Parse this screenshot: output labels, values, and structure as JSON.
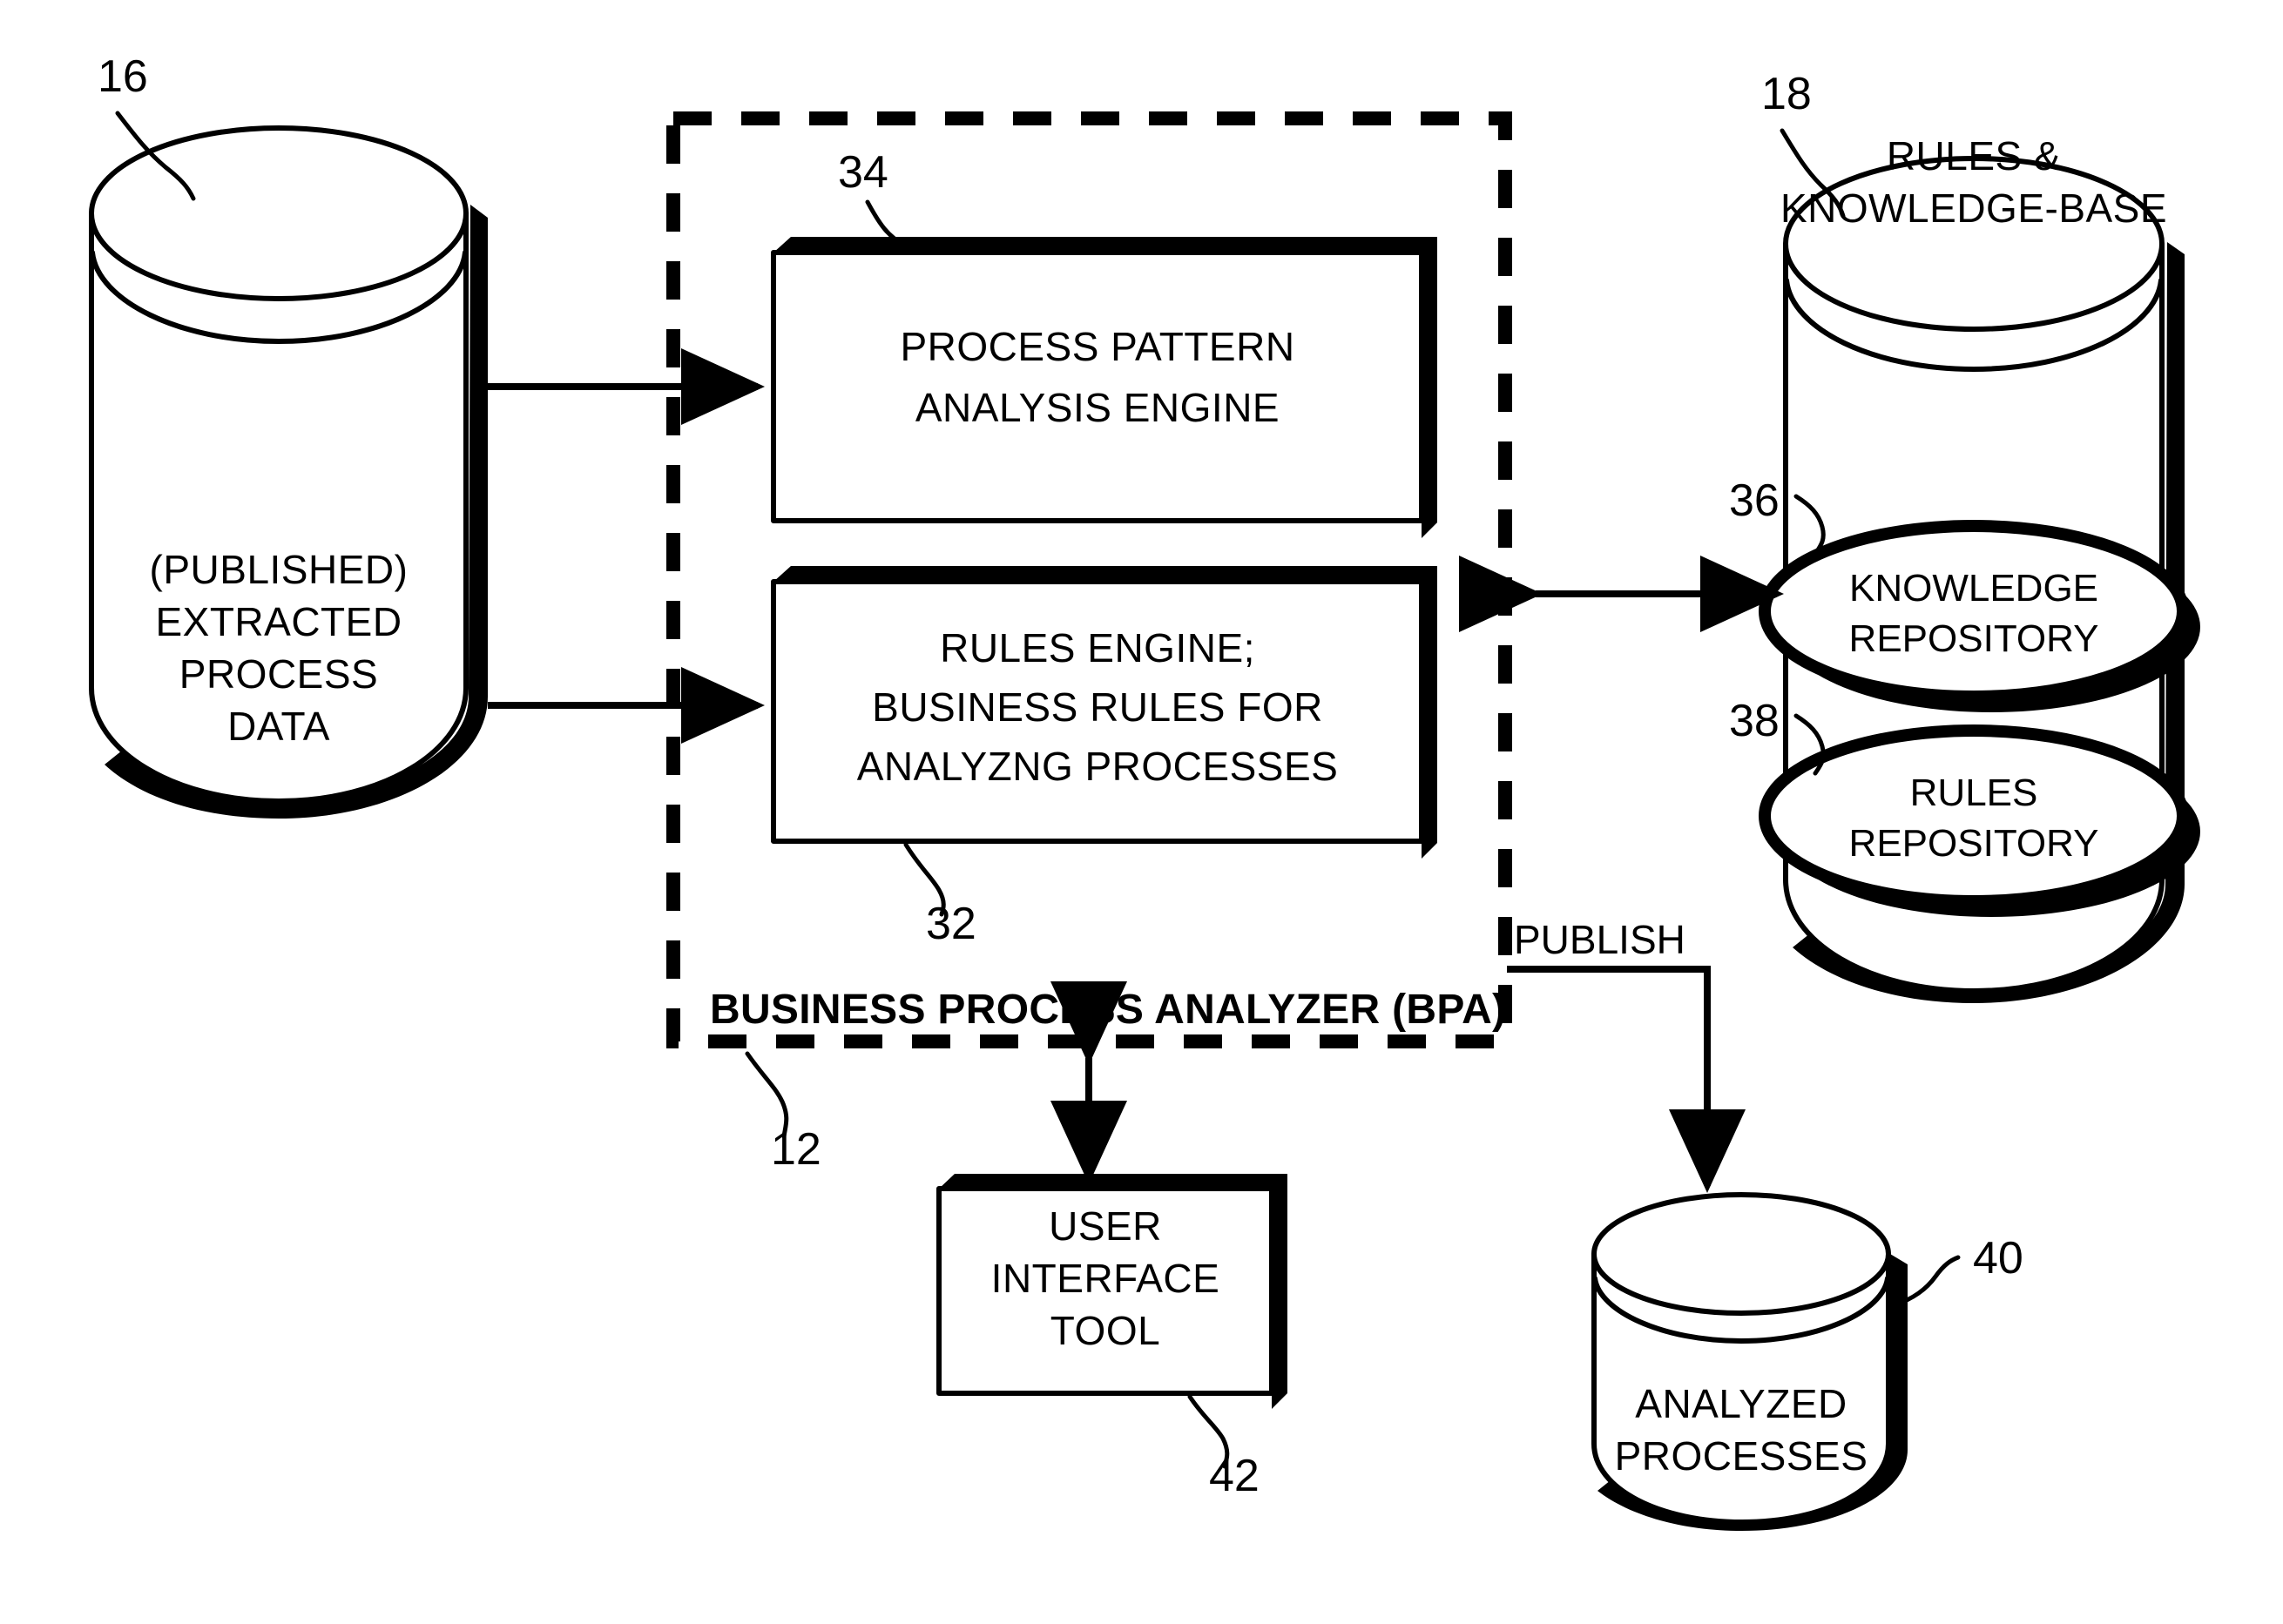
{
  "figure": {
    "type": "patent-block-diagram",
    "background_color": "#ffffff",
    "line_color": "#000000"
  },
  "nodes": {
    "extracted_process_data": {
      "ref": "16",
      "shape": "cylinder",
      "lines": [
        "(PUBLISHED)",
        "EXTRACTED",
        "PROCESS",
        "DATA"
      ]
    },
    "process_pattern_engine": {
      "ref": "34",
      "shape": "box-3d",
      "lines": [
        "PROCESS PATTERN",
        "ANALYSIS ENGINE"
      ]
    },
    "rules_engine": {
      "ref": "32",
      "shape": "box-3d",
      "lines": [
        "RULES ENGINE;",
        "BUSINESS RULES FOR",
        "ANALYZNG PROCESSES"
      ]
    },
    "bpa_container": {
      "ref": "12",
      "shape": "dashed-rectangle",
      "title": "BUSINESS PROCESS ANALYZER (BPA)"
    },
    "rules_knowledge_base": {
      "ref": "18",
      "shape": "cylinder",
      "lines": [
        "RULES &",
        "KNOWLEDGE-BASE"
      ]
    },
    "knowledge_repository": {
      "ref": "36",
      "shape": "ellipse-3d",
      "lines": [
        "KNOWLEDGE",
        "REPOSITORY"
      ]
    },
    "rules_repository": {
      "ref": "38",
      "shape": "ellipse-3d",
      "lines": [
        "RULES",
        "REPOSITORY"
      ]
    },
    "user_interface_tool": {
      "ref": "42",
      "shape": "box-3d",
      "lines": [
        "USER",
        "INTERFACE",
        "TOOL"
      ]
    },
    "analyzed_processes": {
      "ref": "40",
      "shape": "cylinder",
      "lines": [
        "ANALYZED",
        "PROCESSES"
      ]
    }
  },
  "connectors": {
    "data_to_pattern_engine": {
      "label": "",
      "direction": "right"
    },
    "data_to_rules_engine": {
      "label": "",
      "direction": "right"
    },
    "bpa_to_knowledge_base": {
      "label": "",
      "direction": "both"
    },
    "bpa_to_ui_tool": {
      "label": "",
      "direction": "both"
    },
    "bpa_to_analyzed": {
      "label": "PUBLISH",
      "direction": "down"
    }
  }
}
